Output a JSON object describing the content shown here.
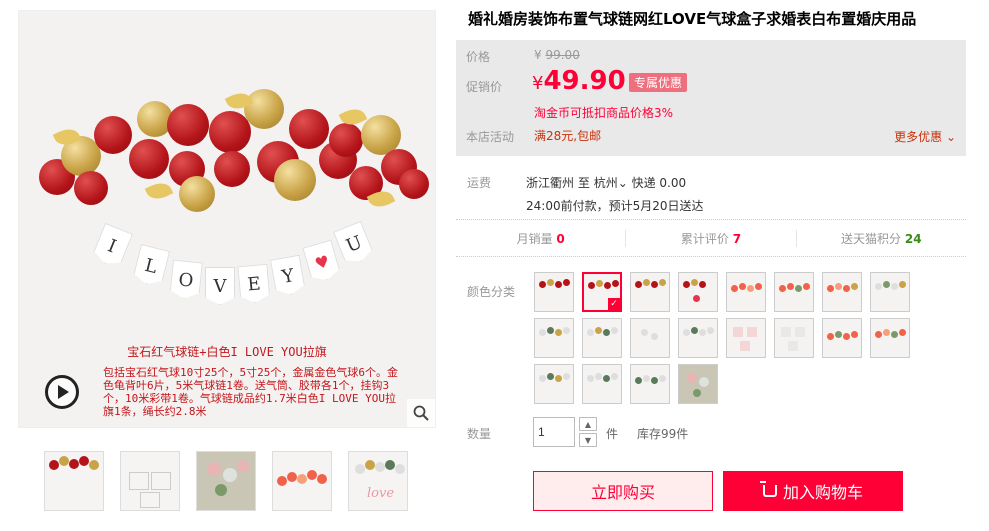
{
  "product": {
    "title": "婚礼婚房装饰布置气球链网红LOVE气球盒子求婚表白布置婚庆用品"
  },
  "main_image": {
    "banner_letters": [
      "I",
      "L",
      "O",
      "V",
      "E",
      "Y",
      "U"
    ],
    "caption": "宝石红气球链+白色I LOVE YOU拉旗",
    "desc": "包括宝石红气球10寸25个，5寸25个，金属金色气球6个。金色龟背叶6片，5米气球链1卷。送气筒、胶带各1个，挂钩3个，10米彩带1卷。气球链成品约1.7米白色I LOVE YOU拉旗1条，绳长约2.8米"
  },
  "price": {
    "orig_label": "价格",
    "orig_currency": "¥",
    "orig_value": "99.00",
    "promo_label": "促销价",
    "promo_currency": "¥",
    "promo_value": "49.90",
    "promo_badge": "专属优惠",
    "tmall_note": "淘金币可抵扣商品价格3%",
    "shop_activity_label": "本店活动",
    "shop_activity": "满28元,包邮",
    "more_promo": "更多优惠"
  },
  "shipping": {
    "label": "运费",
    "from": "浙江衢州",
    "to_word": "至",
    "to_city": "杭州",
    "method": "快递 0.00",
    "eta": "24:00前付款，预计5月20日送达"
  },
  "stats": {
    "monthly_sales_label": "月销量",
    "monthly_sales": "0",
    "reviews_label": "累计评价",
    "reviews": "7",
    "points_label": "送天猫积分",
    "points": "24"
  },
  "color_label": "颜色分类",
  "quantity": {
    "label": "数量",
    "value": "1",
    "unit": "件",
    "stock": "库存99件"
  },
  "buttons": {
    "buy_now": "立即购买",
    "add_cart": "加入购物车"
  },
  "colors": {
    "accent": "#ff0036",
    "price_box_bg": "#e9e9e9",
    "activity_text": "#c8320a"
  }
}
